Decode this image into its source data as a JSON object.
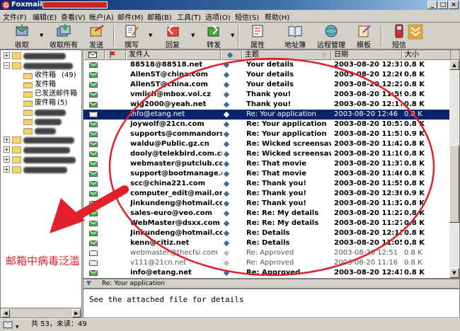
{
  "window": {
    "title": "Foxmail"
  },
  "menu": [
    "文件(F)",
    "编辑(E)",
    "查看(V)",
    "帐户(A)",
    "邮件(M)",
    "邮箱(B)",
    "工具(T)",
    "选项(O)",
    "短信(S)",
    "帮助(H)"
  ],
  "toolbar": {
    "buttons": [
      {
        "label": "收取",
        "icon": "receive-icon"
      },
      {
        "label": "收取所有",
        "icon": "receive-all-icon"
      },
      {
        "label": "发送",
        "icon": "send-icon"
      },
      {
        "label": "撰写",
        "icon": "compose-icon"
      },
      {
        "label": "回复",
        "icon": "reply-icon"
      },
      {
        "label": "转发",
        "icon": "forward-icon"
      },
      {
        "label": "属性",
        "icon": "properties-icon"
      },
      {
        "label": "地址簿",
        "icon": "address-book-icon"
      },
      {
        "label": "远程管理",
        "icon": "remote-manage-icon"
      },
      {
        "label": "模板",
        "icon": "template-icon"
      },
      {
        "label": "短信",
        "icon": "sms-icon"
      }
    ]
  },
  "folders": [
    {
      "name": "收件箱",
      "count": "(49)"
    },
    {
      "name": "发件箱",
      "count": ""
    },
    {
      "name": "已发送邮件箱",
      "count": ""
    },
    {
      "name": "废件箱",
      "count": "(5)"
    }
  ],
  "columns": {
    "sender": "发件人",
    "subject": "主题",
    "date": "日期",
    "size": "大小"
  },
  "emails": [
    {
      "sender": "88518@88518.net",
      "subject": "Your details",
      "date": "2003-08-20 12:31",
      "size": "0.8 K",
      "read": false,
      "selected": false
    },
    {
      "sender": "AllenST@china.com",
      "subject": "Your details",
      "date": "2003-08-20 12:26",
      "size": "0.8 K",
      "read": false,
      "selected": false
    },
    {
      "sender": "AllenST@china.com",
      "subject": "Your details",
      "date": "2003-08-20 12:22",
      "size": "0.8 K",
      "read": false,
      "selected": false
    },
    {
      "sender": "vmlich@mbox.vol.cz",
      "subject": "Thank you!",
      "date": "2003-08-20 11:59",
      "size": "0.8 K",
      "read": false,
      "selected": false
    },
    {
      "sender": "wjg2000@yeah.net",
      "subject": "Thank you!",
      "date": "2003-08-20 12:17",
      "size": "0.8 K",
      "read": false,
      "selected": false
    },
    {
      "sender": "info@etang.net",
      "subject": "Re: Your application",
      "date": "2003-08-20 12:46",
      "size": "0.8 K",
      "read": true,
      "selected": true
    },
    {
      "sender": "joywolf@21cn.com",
      "subject": "Re: Your application",
      "date": "2003-08-20 10:57",
      "size": "0.8 K",
      "read": false,
      "selected": false
    },
    {
      "sender": "supports@commandorso...",
      "subject": "Re: Your application",
      "date": "2003-08-20 11:51",
      "size": "0.9 K",
      "read": false,
      "selected": false
    },
    {
      "sender": "waldu@Public.gz.cn",
      "subject": "Re: Wicked screensaver",
      "date": "2003-08-20 11:42",
      "size": "0.8 K",
      "read": false,
      "selected": false
    },
    {
      "sender": "dooly@telekbird.com.cn",
      "subject": "Re: Wicked screensaver",
      "date": "2003-08-20 11:10",
      "size": "0.8 K",
      "read": false,
      "selected": false
    },
    {
      "sender": "webmaster@putclub.com",
      "subject": "Re: That movie",
      "date": "2003-08-20 11:37",
      "size": "0.8 K",
      "read": false,
      "selected": false
    },
    {
      "sender": "support@bootmanage.de",
      "subject": "Re: That movie",
      "date": "2003-08-20 11:46",
      "size": "0.8 K",
      "read": false,
      "selected": false
    },
    {
      "sender": "scc@china221.com",
      "subject": "Re: Thank you!",
      "date": "2003-08-20 11:55",
      "size": "0.8 K",
      "read": false,
      "selected": false
    },
    {
      "sender": "computer_edit@mail.onli...",
      "subject": "Re: Thank you!",
      "date": "2003-08-20 12:36",
      "size": "0.9 K",
      "read": false,
      "selected": false
    },
    {
      "sender": "Jinkundeng@hotmail.com",
      "subject": "Re: Thank you!",
      "date": "2003-08-20 11:32",
      "size": "0.8 K",
      "read": false,
      "selected": false
    },
    {
      "sender": "sales-euro@veo.com",
      "subject": "Re: Re: My details",
      "date": "2003-08-20 11:22",
      "size": "0.8 K",
      "read": false,
      "selected": false
    },
    {
      "sender": "WebMaster@dsxx.com",
      "subject": "Re: Re: My details",
      "date": "2003-08-20 11:27",
      "size": "0.8 K",
      "read": false,
      "selected": false
    },
    {
      "sender": "Jinkundeng@hotmail.com",
      "subject": "Re: Details",
      "date": "2003-08-20 12:13",
      "size": "0.8 K",
      "read": false,
      "selected": false
    },
    {
      "sender": "kenn@citiz.net",
      "subject": "Re: Details",
      "date": "2003-08-20 11:05",
      "size": "0.8 K",
      "read": false,
      "selected": false
    },
    {
      "sender": "webmaster@thecfsi.com",
      "subject": "Re: Approved",
      "date": "2003-08-20 12:51",
      "size": "0.8 K",
      "read": true,
      "selected": false
    },
    {
      "sender": "v111@21cn.net",
      "subject": "Re: Approved",
      "date": "2003-08-20 11:16",
      "size": "0.8 K",
      "read": true,
      "selected": false
    },
    {
      "sender": "info@etang.net",
      "subject": "Re: Approved",
      "date": "2003-08-20 12:41",
      "size": "0.8 K",
      "read": false,
      "selected": false
    }
  ],
  "preview": {
    "subject": "Re: Your application",
    "body": "See the attached file for details"
  },
  "status": {
    "total": "共 53，未读：49"
  },
  "annotation": {
    "text": "邮箱中病毒泛滥"
  },
  "colors": {
    "annotation_red": "#e0202a",
    "selection": "#0a246a",
    "unread_env": "#3cb043"
  }
}
